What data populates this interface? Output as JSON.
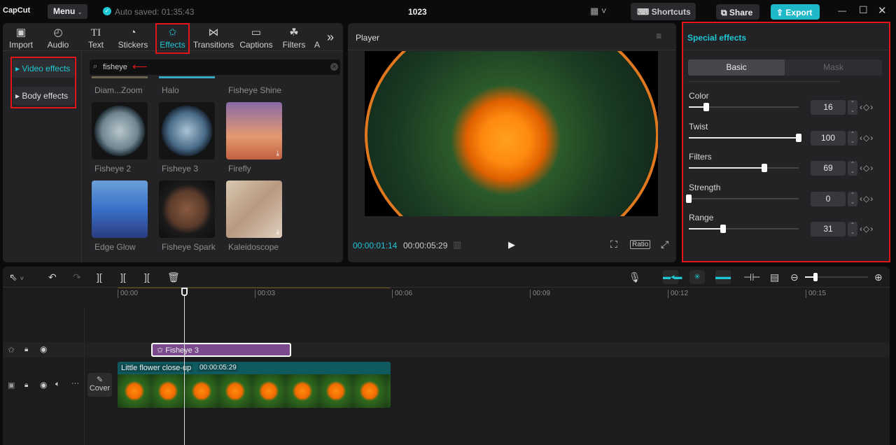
{
  "topbar": {
    "logo": "CapCut",
    "menu": "Menu",
    "autosave": "Auto saved: 01:35:43",
    "title": "1023",
    "shortcuts": "Shortcuts",
    "share": "Share",
    "export": "Export"
  },
  "tabs": [
    {
      "label": "Import",
      "icon": "import-icon"
    },
    {
      "label": "Audio",
      "icon": "audio-icon"
    },
    {
      "label": "Text",
      "icon": "text-icon"
    },
    {
      "label": "Stickers",
      "icon": "stickers-icon"
    },
    {
      "label": "Effects",
      "icon": "effects-icon"
    },
    {
      "label": "Transitions",
      "icon": "transitions-icon"
    },
    {
      "label": "Captions",
      "icon": "captions-icon"
    },
    {
      "label": "Filters",
      "icon": "filters-icon"
    },
    {
      "label": "A",
      "icon": ""
    }
  ],
  "sidebar": {
    "items": [
      "Video effects",
      "Body effects"
    ]
  },
  "search": {
    "value": "fisheye"
  },
  "effects": [
    "Diam...Zoom",
    "Halo",
    "Fisheye Shine",
    "Fisheye 2",
    "Fisheye 3",
    "Firefly",
    "Edge Glow",
    "Fisheye Spark",
    "Kaleidoscope"
  ],
  "player": {
    "title": "Player",
    "current": "00:00:01:14",
    "total": "00:00:05:29",
    "ratio": "Ratio"
  },
  "special": {
    "title": "Special effects",
    "tabs": [
      "Basic",
      "Mask"
    ],
    "params": [
      {
        "label": "Color",
        "value": 16
      },
      {
        "label": "Twist",
        "value": 100
      },
      {
        "label": "Filters",
        "value": 69
      },
      {
        "label": "Strength",
        "value": 0
      },
      {
        "label": "Range",
        "value": 31
      }
    ]
  },
  "timeline": {
    "ruler": [
      "00:00",
      "00:03",
      "00:06",
      "00:09",
      "00:12",
      "00:15"
    ],
    "effect_clip": "Fisheye 3",
    "video_clip": "Little flower close-up",
    "video_duration": "00:00:05:29",
    "cover": "Cover"
  },
  "colors": {
    "accent": "#1fc7d4",
    "highlight": "#e0161b",
    "effect_clip": "#7a4a8c",
    "video_clip": "#0f5a5e"
  }
}
